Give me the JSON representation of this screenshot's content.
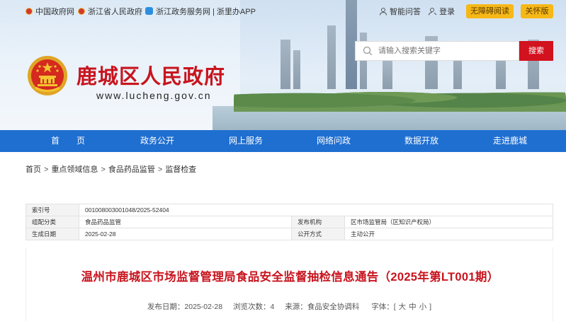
{
  "topbar": {
    "links": [
      "中国政府网",
      "浙江省人民政府",
      "浙江政务服务网",
      "| 浙里办APP"
    ],
    "smart_qa": "智能问答",
    "login": "登录",
    "accessibility": "无障碍阅读",
    "elderly": "关怀版"
  },
  "header": {
    "site_title": "鹿城区人民政府",
    "site_url": "www.lucheng.gov.cn",
    "search_placeholder": "请输入搜索关键字",
    "search_button": "搜索"
  },
  "nav": {
    "items": [
      "首　　页",
      "政务公开",
      "网上服务",
      "网络问政",
      "数据开放",
      "走进鹿城"
    ]
  },
  "breadcrumb": [
    "首页",
    "重点领域信息",
    "食品药品监管",
    "监督检查"
  ],
  "breadcrumb_sep": ">",
  "info_table": {
    "index_label": "索引号",
    "index_value": "001008003001048/2025-52404",
    "category_label": "组配分类",
    "category_value": "食品药品监管",
    "issuer_label": "发布机构",
    "issuer_value": "区市场监管局（区知识产权局）",
    "date_label": "生成日期",
    "date_value": "2025-02-28",
    "method_label": "公开方式",
    "method_value": "主动公开"
  },
  "article": {
    "title": "温州市鹿城区市场监督管理局食品安全监督抽检信息通告（2025年第LT001期）",
    "publish_date": "发布日期：2025-02-28",
    "views": "浏览次数：4",
    "source": "来源：食品安全协调科",
    "font_label": "字体：[",
    "font_large": "大",
    "font_medium": "中",
    "font_small": "小",
    "font_close": "]"
  },
  "colors": {
    "brand_red": "#c8141e",
    "nav_blue": "#1f6fd1",
    "button_yellow": "#f6b817"
  }
}
